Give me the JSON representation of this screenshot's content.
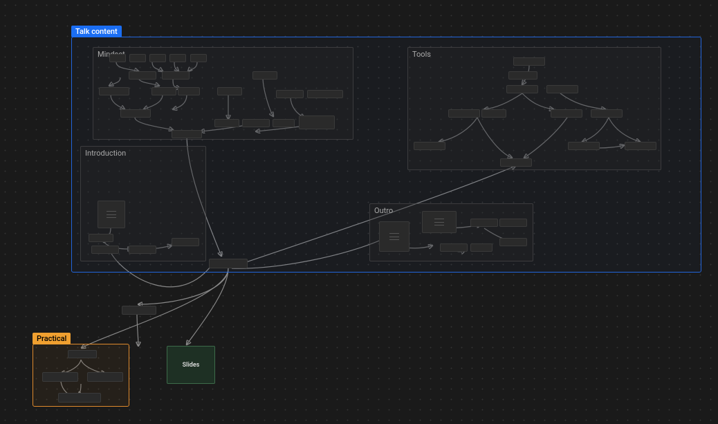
{
  "groups": {
    "talk_content": {
      "label": "Talk content",
      "color_border": "#2266dd",
      "color_bg": "rgba(40,60,120,0.08)",
      "label_bg": "#1b6ef3",
      "label_fg": "#fff"
    },
    "practical": {
      "label": "Practical",
      "color_border": "#e08a2c",
      "color_bg": "rgba(120,80,30,0.12)",
      "label_bg": "#f0a030",
      "label_fg": "#000"
    }
  },
  "subgroups": {
    "mindset": {
      "label": "Mindset"
    },
    "tools": {
      "label": "Tools"
    },
    "introduction": {
      "label": "Introduction"
    },
    "outro": {
      "label": "Outro"
    }
  },
  "slides_label": "Slides"
}
